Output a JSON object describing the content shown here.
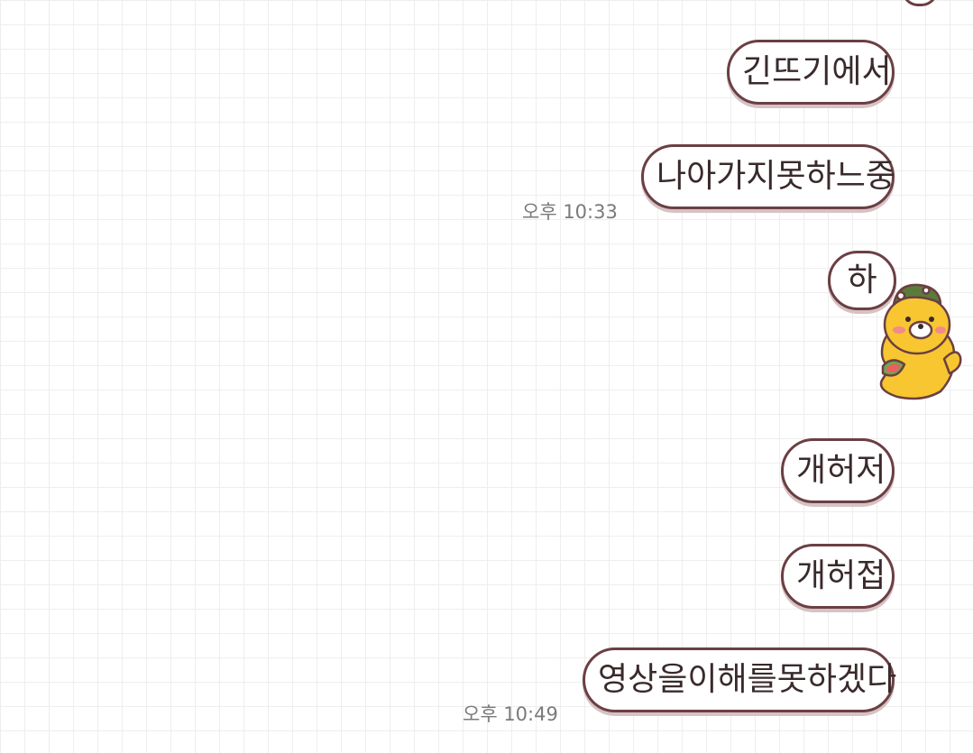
{
  "messages": [
    {
      "text": "긴뜨기에서"
    },
    {
      "text": "나아가지못하느중"
    },
    {
      "text": "하"
    },
    {
      "text": "개허저"
    },
    {
      "text": "개허접"
    },
    {
      "text": "영상을이해를못하겠다"
    }
  ],
  "timestamps": [
    {
      "text": "오후 10:33"
    },
    {
      "text": "오후 10:49"
    }
  ],
  "sticker": {
    "icon": "lion-character-icon",
    "color": "#f7c630"
  },
  "colors": {
    "bubble_border": "#6b3f43",
    "bubble_shadow": "#d6c2c4",
    "timestamp": "#7a7a7a"
  }
}
